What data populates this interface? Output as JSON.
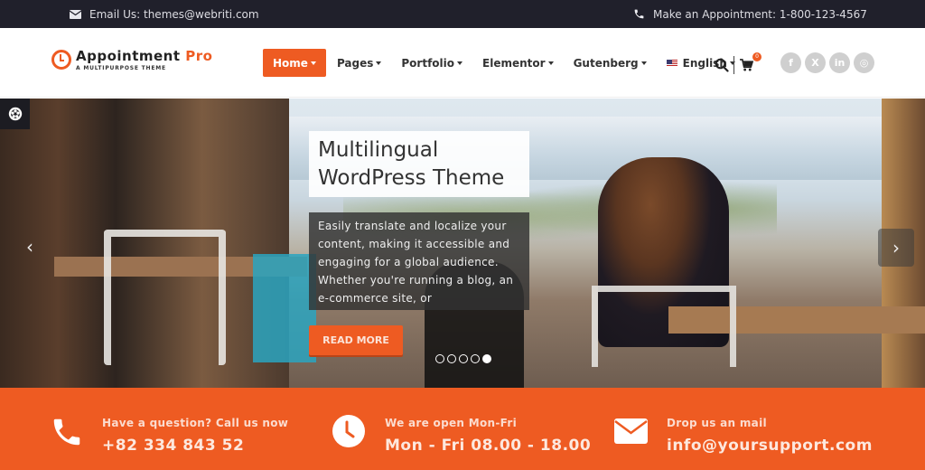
{
  "topbar": {
    "email_text": "Email Us: themes@webriti.com",
    "phone_text": "Make an Appointment: 1-800-123-4567"
  },
  "logo": {
    "name_main": "Appointment",
    "name_accent": "Pro",
    "tagline": "A MULTIPURPOSE THEME"
  },
  "nav": {
    "items": [
      {
        "label": "Home",
        "active": true
      },
      {
        "label": "Pages"
      },
      {
        "label": "Portfolio"
      },
      {
        "label": "Elementor"
      },
      {
        "label": "Gutenberg"
      },
      {
        "label": "English"
      }
    ],
    "cart_count": "0"
  },
  "social": {
    "items": [
      "facebook",
      "x-twitter",
      "linkedin",
      "instagram"
    ],
    "glyphs": [
      "f",
      "X",
      "in",
      "◎"
    ]
  },
  "slider": {
    "title": "Multilingual WordPress Theme",
    "description": "Easily translate and localize your content, making it accessible and engaging for a global audience. Whether you're running a blog, an e-commerce site, or",
    "button_label": "READ MORE",
    "prev_glyph": "‹",
    "next_glyph": "›",
    "slide_count": 5,
    "active_slide": 5
  },
  "contact": {
    "items": [
      {
        "label": "Have a question? Call us now",
        "value": "+82 334 843 52",
        "icon": "phone-icon"
      },
      {
        "label": "We are open Mon-Fri",
        "value": "Mon - Fri 08.00 - 18.00",
        "icon": "clock-icon"
      },
      {
        "label": "Drop us an mail",
        "value": "info@yoursupport.com",
        "icon": "mail-icon"
      }
    ]
  },
  "colors": {
    "accent": "#ee5b22",
    "topbar_bg": "#20202b",
    "social_bg": "#cfcfcf"
  }
}
